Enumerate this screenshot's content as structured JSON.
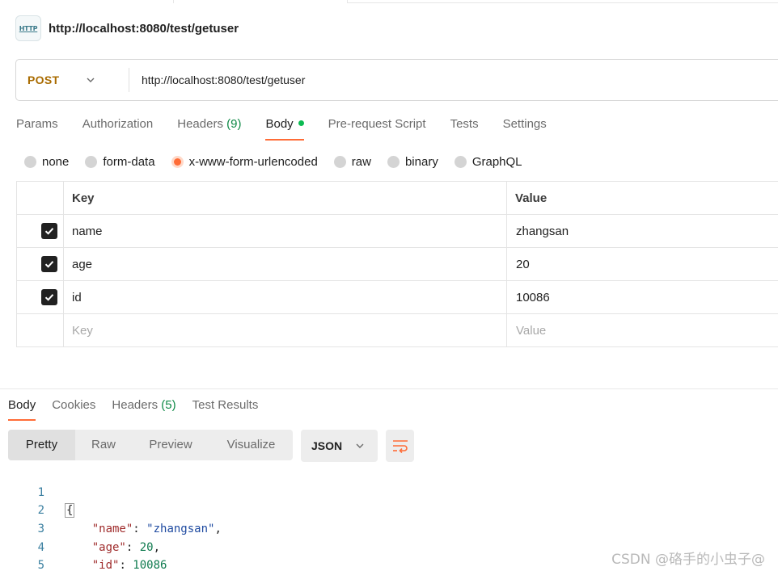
{
  "request": {
    "title": "http://localhost:8080/test/getuser",
    "icon": "http-request-icon",
    "icon_label": "HTTP",
    "method": "POST",
    "url": "http://localhost:8080/test/getuser"
  },
  "request_tabs": [
    {
      "label": "Params"
    },
    {
      "label": "Authorization"
    },
    {
      "label": "Headers",
      "count": "(9)"
    },
    {
      "label": "Body",
      "active": true,
      "indicator": "green-dot"
    },
    {
      "label": "Pre-request Script"
    },
    {
      "label": "Tests"
    },
    {
      "label": "Settings"
    }
  ],
  "body_types": [
    {
      "label": "none"
    },
    {
      "label": "form-data"
    },
    {
      "label": "x-www-form-urlencoded",
      "selected": true
    },
    {
      "label": "raw"
    },
    {
      "label": "binary"
    },
    {
      "label": "GraphQL"
    }
  ],
  "params_table": {
    "headers": {
      "key": "Key",
      "value": "Value"
    },
    "rows": [
      {
        "checked": true,
        "key": "name",
        "value": "zhangsan"
      },
      {
        "checked": true,
        "key": "age",
        "value": "20"
      },
      {
        "checked": true,
        "key": "id",
        "value": "10086"
      }
    ],
    "placeholder": {
      "key": "Key",
      "value": "Value"
    }
  },
  "response_tabs": [
    {
      "label": "Body",
      "active": true
    },
    {
      "label": "Cookies"
    },
    {
      "label": "Headers",
      "count": "(5)"
    },
    {
      "label": "Test Results"
    }
  ],
  "view_modes": [
    {
      "label": "Pretty",
      "active": true
    },
    {
      "label": "Raw"
    },
    {
      "label": "Preview"
    },
    {
      "label": "Visualize"
    }
  ],
  "format": {
    "label": "JSON"
  },
  "response_body": {
    "line_numbers": [
      "1",
      "2",
      "3",
      "4",
      "5"
    ],
    "open_brace": "{",
    "close_brace": "}",
    "fields": [
      {
        "key": "\"name\"",
        "value": "\"zhangsan\"",
        "kind": "string",
        "trail": ","
      },
      {
        "key": "\"age\"",
        "value": "20",
        "kind": "number",
        "trail": ","
      },
      {
        "key": "\"id\"",
        "value": "10086",
        "kind": "number",
        "trail": ""
      }
    ]
  },
  "colors": {
    "accent": "#ff6c37",
    "method_post": "#a96b00",
    "count_green": "#0f8a47",
    "active_dot": "#0cbb52"
  },
  "watermark": "CSDN @硌手的小虫子@"
}
